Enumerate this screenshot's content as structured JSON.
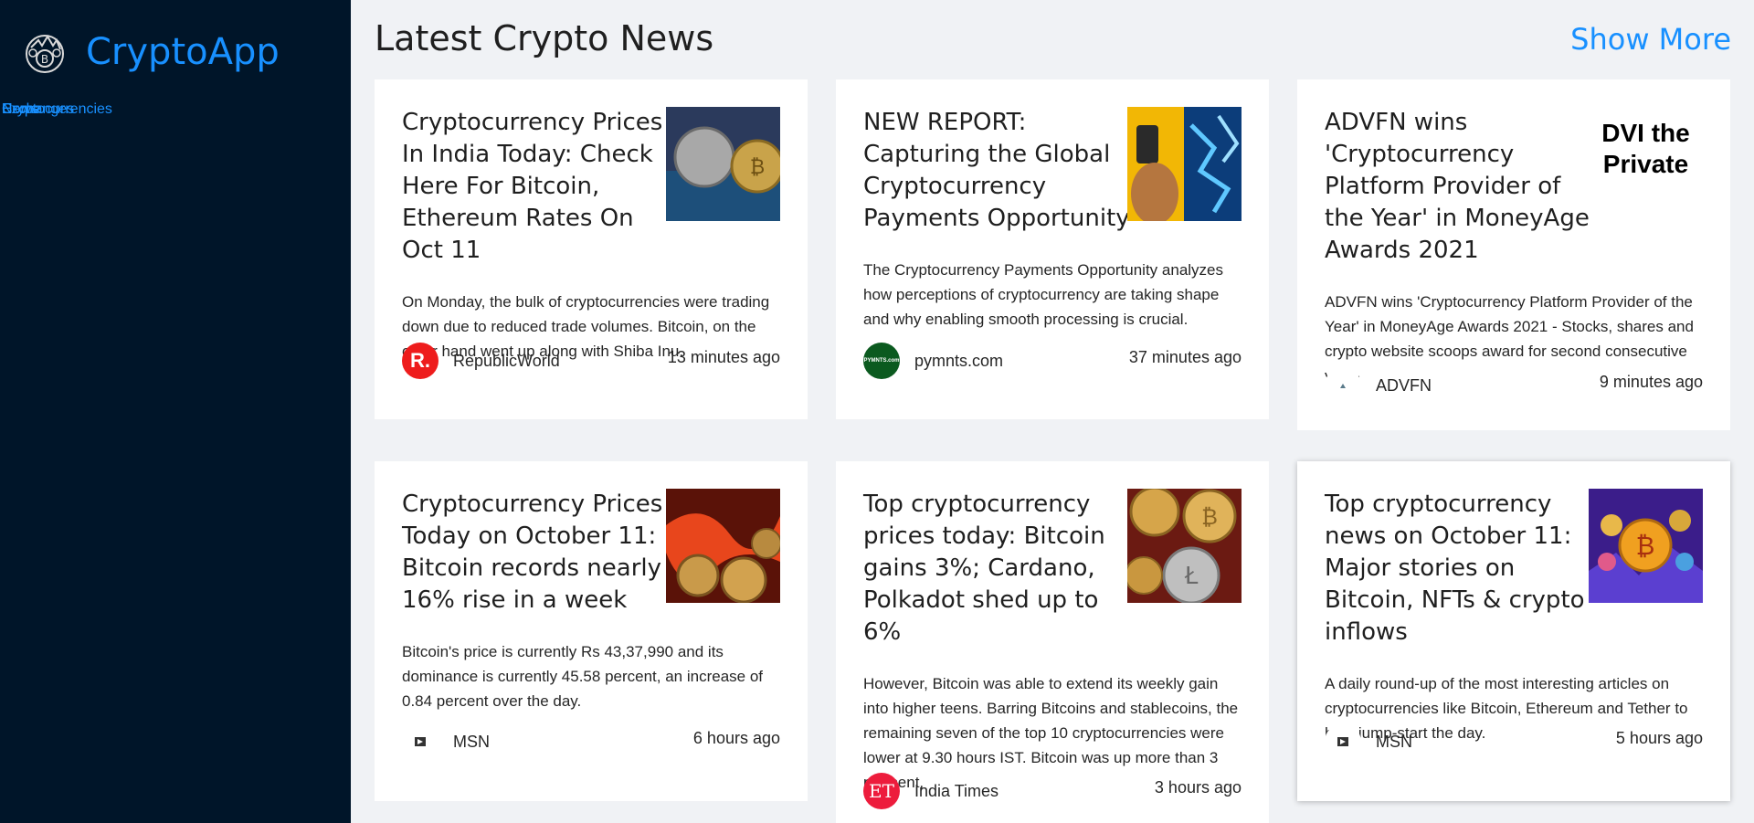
{
  "app": {
    "name": "CryptoApp"
  },
  "sidebar": {
    "nav_items": [
      {
        "label": "Home"
      },
      {
        "label": "Cryptocurrencies"
      },
      {
        "label": "Exchanges"
      },
      {
        "label": "News"
      }
    ]
  },
  "main": {
    "title": "Latest Crypto News",
    "show_more": "Show More"
  },
  "news": [
    {
      "title": "Cryptocurrency Prices In India Today: Check Here For Bitcoin, Ethereum Rates On Oct 11",
      "description": "On Monday, the bulk of cryptocurrencies were trading down due to reduced trade volumes. Bitcoin, on the other hand went up along with Shiba Inu.",
      "provider": "RepublicWorld",
      "provider_avatar_text": "R.",
      "time": "13 minutes ago"
    },
    {
      "title": "NEW REPORT: Capturing the Global Cryptocurrency Payments Opportunity",
      "description": "The Cryptocurrency Payments Opportunity analyzes how perceptions of cryptocurrency are taking shape and why enabling smooth processing is crucial.",
      "provider": "pymnts.com",
      "provider_avatar_text": "PYMNTS.com",
      "time": "37 minutes ago"
    },
    {
      "title": "ADVFN wins 'Cryptocurrency Platform Provider of the Year' in MoneyAge Awards 2021",
      "description": "ADVFN wins 'Cryptocurrency Platform Provider of the Year' in MoneyAge Awards 2021 - Stocks, shares and crypto website scoops award for second consecutive year-",
      "provider": "ADVFN",
      "provider_avatar_text": "",
      "thumb_text": "DVI the Private",
      "time": "9 minutes ago"
    },
    {
      "title": "Cryptocurrency Prices Today on October 11: Bitcoin records nearly 16% rise in a week",
      "description": "Bitcoin's price is currently Rs 43,37,990 and its dominance is currently 45.58 percent, an increase of 0.84 percent over the day.",
      "provider": "MSN",
      "provider_avatar_text": "",
      "time": "6 hours ago"
    },
    {
      "title": "Top cryptocurrency prices today: Bitcoin gains 3%; Cardano, Polkadot shed up to 6%",
      "description": "However, Bitcoin was able to extend its weekly gain into higher teens. Barring Bitcoins and stablecoins, the remaining seven of the top 10 cryptocurrencies were lower at 9.30 hours IST. Bitcoin was up more than 3 per cent,",
      "provider": "India Times",
      "provider_avatar_text": "ET",
      "time": "3 hours ago"
    },
    {
      "title": "Top cryptocurrency news on October 11: Major stories on Bitcoin, NFTs & crypto inflows",
      "description": "A daily round-up of the most interesting articles on cryptocurrencies like Bitcoin, Ethereum and Tether to help jump-start the day.",
      "provider": "MSN",
      "provider_avatar_text": "",
      "time": "5 hours ago"
    }
  ]
}
